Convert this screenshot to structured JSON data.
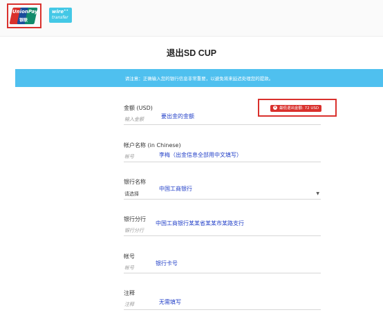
{
  "payment_methods": {
    "unionpay": {
      "brand": "UnionPay",
      "cn": "银联",
      "colors": [
        "#d9302c",
        "#1b4d9b",
        "#128b6c"
      ],
      "selected": true
    },
    "wire": {
      "line1": "wire",
      "line2": "transfer",
      "mark": "••"
    }
  },
  "title": "退出SD CUP",
  "notice": "请注意：正确输入您的银行信息非常重要，以避免将来延迟处理您的提款。",
  "min_amount_badge": "最低退出金额: 72 USD",
  "fields": [
    {
      "label": "金额 (USD)",
      "placeholder": "输入金额",
      "hint": "要出金的金额"
    },
    {
      "label": "帐户名称 (in Chinese)",
      "placeholder": "帐号",
      "hint": "李梅（出金信息全部用中文填写）"
    },
    {
      "label": "银行名称",
      "selected": "请选择",
      "hint": "中国工商银行"
    },
    {
      "label": "银行分行",
      "placeholder": "银行分行",
      "hint": "中国工商银行某某省某某市某路支行"
    },
    {
      "label": "帐号",
      "placeholder": "帐号",
      "hint": "银行卡号"
    },
    {
      "label": "注释",
      "placeholder": "注释",
      "hint": "无需填写"
    }
  ],
  "colors": {
    "accent": "#4fc0ef",
    "hint": "#2340c8",
    "alert": "#d9302c"
  }
}
